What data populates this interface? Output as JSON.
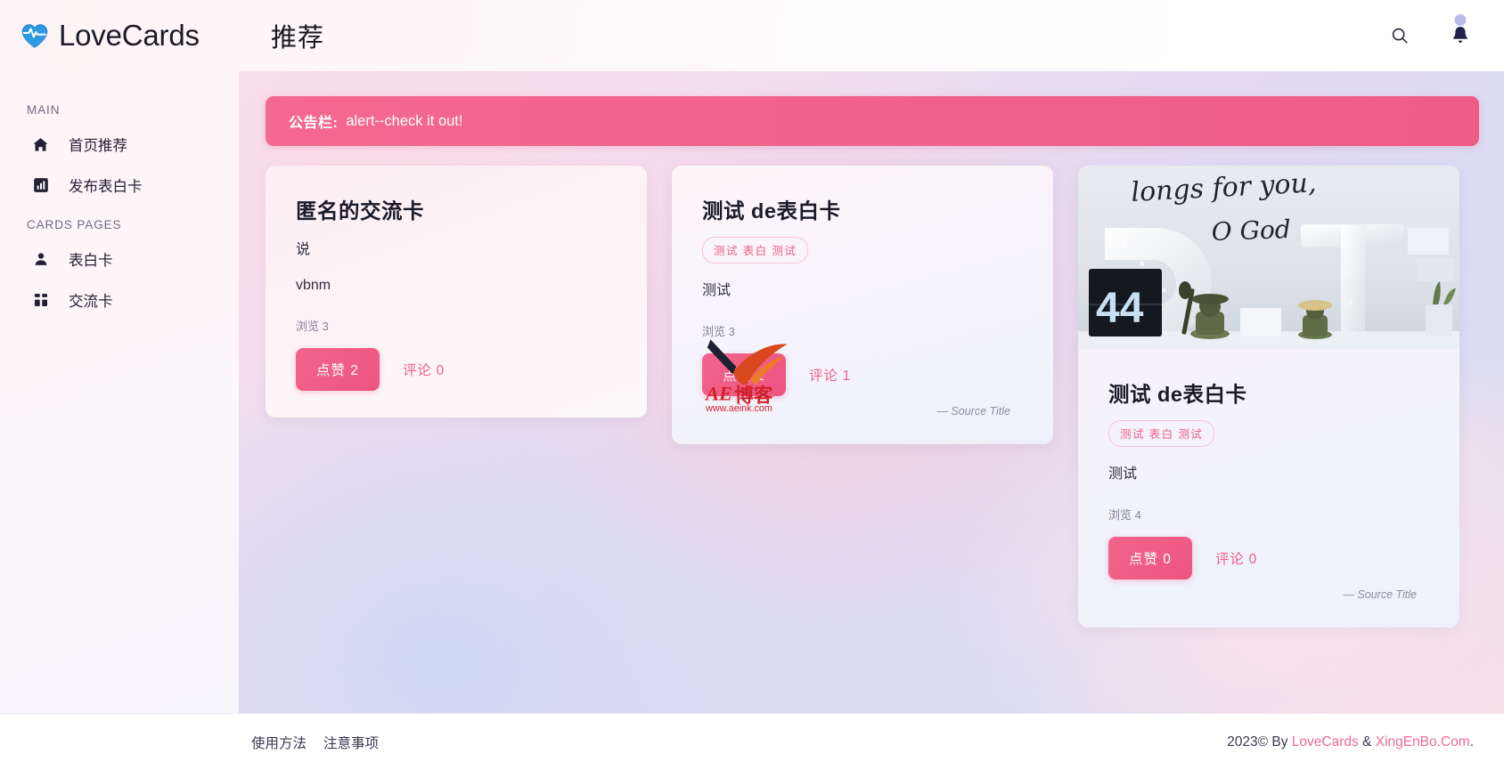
{
  "brand": {
    "name": "LoveCards",
    "logo_icon": "heart-pulse-icon"
  },
  "header": {
    "page_title": "推荐",
    "search_icon": "search-icon",
    "notification_icon": "bell-icon"
  },
  "sidebar": {
    "sections": [
      {
        "label": "MAIN",
        "items": [
          {
            "label": "首页推荐",
            "icon": "home-icon"
          },
          {
            "label": "发布表白卡",
            "icon": "chart-bar-icon"
          }
        ]
      },
      {
        "label": "CARDS PAGES",
        "items": [
          {
            "label": "表白卡",
            "icon": "person-icon"
          },
          {
            "label": "交流卡",
            "icon": "grid-dots-icon"
          }
        ]
      }
    ]
  },
  "announcement": {
    "label": "公告栏:",
    "text": "alert--check it out!",
    "color": "#ef5c87"
  },
  "cards": [
    {
      "title": "匿名的交流卡",
      "subtitle": "说",
      "body": "vbnm",
      "views_label": "浏览 3",
      "like_label": "点赞 2",
      "comment_label": "评论 0",
      "tag": null,
      "source": null,
      "has_photo": false
    },
    {
      "title": "测试 de表白卡",
      "subtitle": null,
      "body": "测试",
      "views_label": "浏览 3",
      "like_label": "点赞 1",
      "comment_label": "评论 1",
      "tag": "测试 表白 测试",
      "source": "— Source Title",
      "has_photo": false
    },
    {
      "title": "测试 de表白卡",
      "subtitle": null,
      "body": "测试",
      "views_label": "浏览 4",
      "like_label": "点赞 0",
      "comment_label": "评论 0",
      "tag": "测试 表白 测试",
      "source": "— Source Title",
      "has_photo": true,
      "photo_alt_text": "longs for you, O God",
      "photo_clock_number": "44"
    }
  ],
  "watermark": {
    "brand_text": "AE博客",
    "url_text": "www.aeink.com"
  },
  "footer": {
    "links": [
      "使用方法",
      "注意事项"
    ],
    "copyright_prefix": "2023© By ",
    "link_1": "LoveCards",
    "separator": " & ",
    "link_2": "XingEnBo.Com",
    "suffix": "."
  },
  "colors": {
    "accent_pink": "#ef5c87",
    "navy": "#232135",
    "link_pink": "#ef6a92"
  }
}
